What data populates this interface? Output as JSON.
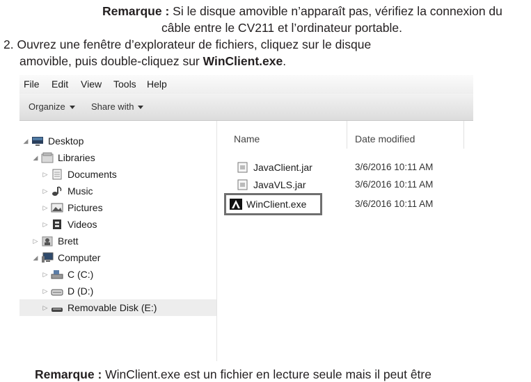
{
  "doc": {
    "note1_label": "Remarque :",
    "note1_text_a": " Si le disque amovible n’apparaît pas, vérifiez la connexion du",
    "note1_text_b": "câble entre le CV211 et l’ordinateur portable.",
    "step2_a": "2. Ouvrez une fenêtre d’explorateur de fichiers, cliquez sur le disque",
    "step2_b": "amovible, puis double-cliquez sur ",
    "step2_bold": "WinClient.exe",
    "step2_end": ".",
    "note2_label": "Remarque :",
    "note2_text": " WinClient.exe est un fichier en lecture seule mais il peut être"
  },
  "explorer": {
    "menu": [
      "File",
      "Edit",
      "View",
      "Tools",
      "Help"
    ],
    "toolbar": {
      "organize": "Organize",
      "share": "Share with"
    },
    "tree": [
      {
        "label": "Desktop",
        "icon": "desktop-icon",
        "expanded": true
      },
      {
        "label": "Libraries",
        "icon": "libraries-icon",
        "expanded": true
      },
      {
        "label": "Documents",
        "icon": "documents-icon",
        "expanded": false
      },
      {
        "label": "Music",
        "icon": "music-icon",
        "expanded": false
      },
      {
        "label": "Pictures",
        "icon": "pictures-icon",
        "expanded": false
      },
      {
        "label": "Videos",
        "icon": "videos-icon",
        "expanded": false
      },
      {
        "label": "Brett",
        "icon": "user-folder-icon",
        "expanded": false
      },
      {
        "label": "Computer",
        "icon": "computer-icon",
        "expanded": true
      },
      {
        "label": "C (C:)",
        "icon": "drive-c-icon",
        "expanded": false
      },
      {
        "label": "D (D:)",
        "icon": "drive-d-icon",
        "expanded": false
      },
      {
        "label": "Removable Disk (E:)",
        "icon": "removable-disk-icon",
        "expanded": false,
        "selected": true
      }
    ],
    "columns": {
      "name": "Name",
      "date": "Date modified"
    },
    "files": [
      {
        "name": "JavaClient.jar",
        "date": "3/6/2016 10:11 AM",
        "icon": "jar-file-icon"
      },
      {
        "name": "JavaVLS.jar",
        "date": "3/6/2016 10:11 AM",
        "icon": "jar-file-icon"
      },
      {
        "name": "WinClient.exe",
        "date": "3/6/2016 10:11 AM",
        "icon": "app-exe-icon",
        "highlighted": true
      }
    ]
  }
}
